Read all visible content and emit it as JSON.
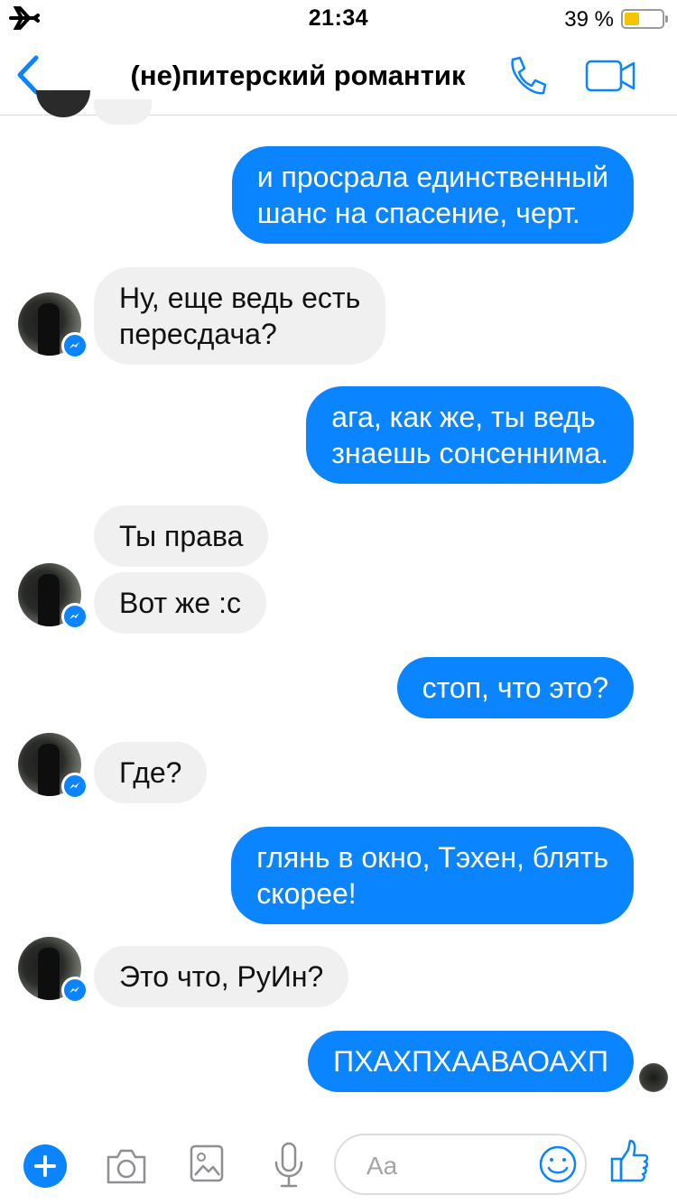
{
  "status_bar": {
    "time": "21:34",
    "battery_text": "39 %",
    "battery_level": 0.39,
    "airplane_icon": "airplane-icon"
  },
  "header": {
    "back_icon": "chevron-left-icon",
    "title": "(не)питерский романтик",
    "call_icon": "phone-icon",
    "video_icon": "video-camera-icon"
  },
  "messages": [
    {
      "direction": "outgoing",
      "text": "и просрала единственный\nшанс на спасение, черт."
    },
    {
      "direction": "incoming",
      "text": "Ну, еще ведь есть\nпересдача?"
    },
    {
      "direction": "outgoing",
      "text": "ага, как же, ты ведь\nзнаешь сонсеннима."
    },
    {
      "direction": "incoming",
      "text": "Ты права"
    },
    {
      "direction": "incoming",
      "text": "Вот же :с"
    },
    {
      "direction": "outgoing",
      "text": "стоп, что это?"
    },
    {
      "direction": "incoming",
      "text": "Где?"
    },
    {
      "direction": "outgoing",
      "text": "глянь в окно, Тэхен, блять\nскорее!"
    },
    {
      "direction": "incoming",
      "text": "Это что, РуИн?"
    },
    {
      "direction": "outgoing",
      "text": "ПХАХПХААВАОАХП"
    }
  ],
  "composer": {
    "placeholder": "Aa",
    "icons": [
      "plus-icon",
      "camera-icon",
      "image-icon",
      "microphone-icon",
      "smiley-icon",
      "thumbs-up-icon"
    ]
  },
  "colors": {
    "accent": "#0a84ff",
    "incoming_bubble": "#f0f0f0",
    "battery": "#f5c400"
  }
}
